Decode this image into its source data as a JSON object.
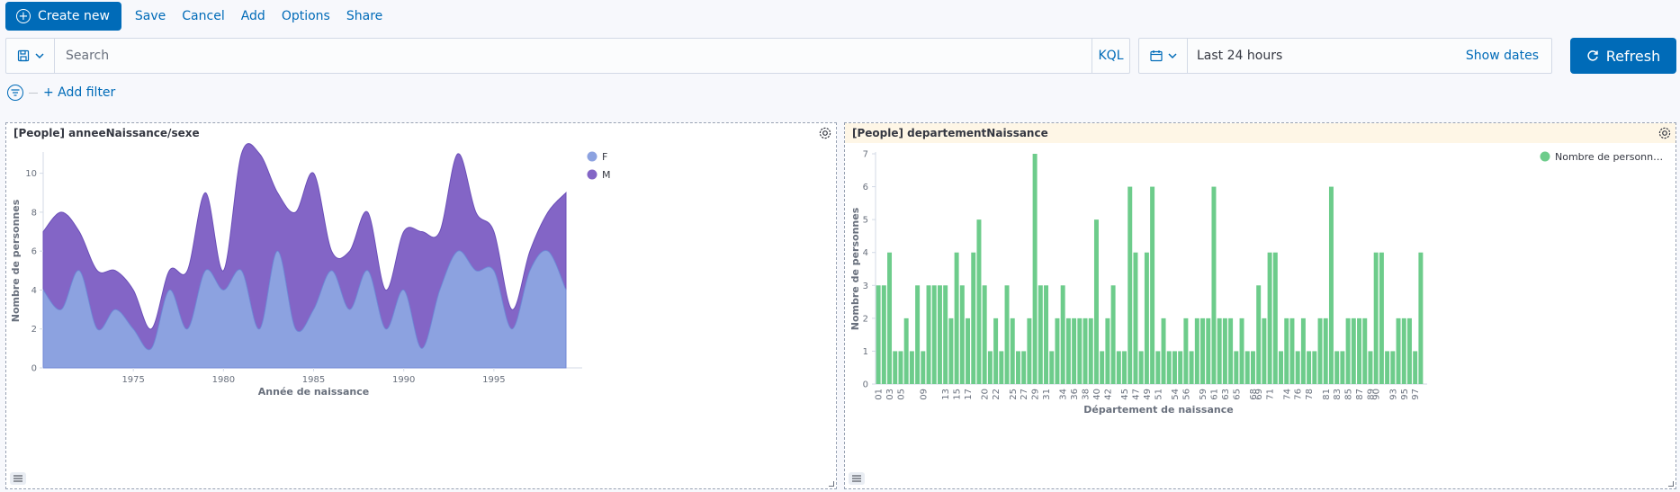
{
  "topnav": {
    "create_label": "Create new",
    "save": "Save",
    "cancel": "Cancel",
    "add": "Add",
    "options": "Options",
    "share": "Share"
  },
  "query": {
    "placeholder": "Search",
    "language": "KQL"
  },
  "time": {
    "range": "Last 24 hours",
    "show_dates": "Show dates"
  },
  "refresh_label": "Refresh",
  "filter": {
    "add_label": "+ Add filter"
  },
  "colors": {
    "accent": "#006bb8",
    "series_f": "#8ca2e0",
    "series_m": "#8365c6",
    "bars": "#6dcc8b"
  },
  "panels": {
    "left_title": "[People] anneeNaissance/sexe",
    "right_title": "[People] departementNaissance"
  },
  "chart_data": [
    {
      "type": "area",
      "stacked": true,
      "title": "",
      "xlabel": "Année de naissance",
      "ylabel": "Nombre de personnes",
      "xlim": [
        1970,
        1999
      ],
      "ylim": [
        0,
        11
      ],
      "xticks": [
        1975,
        1980,
        1985,
        1990,
        1995
      ],
      "yticks": [
        0,
        2,
        4,
        6,
        8,
        10
      ],
      "legend_position": "top-right",
      "x": [
        1970,
        1971,
        1972,
        1973,
        1974,
        1975,
        1976,
        1977,
        1978,
        1979,
        1980,
        1981,
        1982,
        1983,
        1984,
        1985,
        1986,
        1987,
        1988,
        1989,
        1990,
        1991,
        1992,
        1993,
        1994,
        1995,
        1996,
        1997,
        1998,
        1999
      ],
      "series": [
        {
          "name": "F",
          "values": [
            4,
            3,
            5,
            2,
            3,
            2,
            1,
            4,
            2,
            5,
            4,
            5,
            2,
            6,
            2,
            3,
            5,
            3,
            5,
            2,
            4,
            1,
            4,
            6,
            5,
            5,
            2,
            5,
            6,
            4
          ]
        },
        {
          "name": "M",
          "values": [
            3,
            5,
            2,
            3,
            2,
            2,
            1,
            1,
            3,
            4,
            1,
            6,
            9,
            3,
            6,
            7,
            1,
            3,
            3,
            2,
            3,
            6,
            3,
            5,
            3,
            2,
            1,
            1,
            2,
            5
          ]
        }
      ]
    },
    {
      "type": "bar",
      "title": "",
      "xlabel": "Département de naissance",
      "ylabel": "Nombre de personnes",
      "ylim": [
        0,
        7
      ],
      "yticks": [
        0,
        1,
        2,
        3,
        4,
        5,
        6,
        7
      ],
      "legend_position": "top-right",
      "series": [
        {
          "name": "Nombre de personn…"
        }
      ],
      "categories": [
        "01",
        "02",
        "03",
        "04",
        "05",
        "06",
        "07",
        "08",
        "09",
        "10",
        "11",
        "12",
        "13",
        "14",
        "15",
        "16",
        "17",
        "18",
        "19",
        "20",
        "21",
        "22",
        "23",
        "24",
        "25",
        "26",
        "27",
        "28",
        "29",
        "30",
        "31",
        "32",
        "33",
        "34",
        "35",
        "36",
        "37",
        "38",
        "39",
        "40",
        "41",
        "42",
        "43",
        "44",
        "45",
        "46",
        "47",
        "48",
        "49",
        "50",
        "51",
        "52",
        "53",
        "54",
        "55",
        "56",
        "57",
        "58",
        "59",
        "60",
        "61",
        "62",
        "63",
        "64",
        "65",
        "66",
        "67",
        "68",
        "69",
        "70",
        "71",
        "72",
        "73",
        "74",
        "75",
        "76",
        "77",
        "78",
        "79",
        "80",
        "81",
        "82",
        "83",
        "84",
        "85",
        "86",
        "87",
        "88",
        "89",
        "90",
        "91",
        "92",
        "93",
        "94",
        "95",
        "96",
        "97",
        "98"
      ],
      "values": [
        3,
        3,
        4,
        1,
        1,
        2,
        1,
        3,
        1,
        3,
        3,
        3,
        3,
        2,
        4,
        3,
        2,
        4,
        5,
        3,
        1,
        2,
        1,
        3,
        2,
        1,
        1,
        2,
        7,
        3,
        3,
        1,
        2,
        3,
        2,
        2,
        2,
        2,
        2,
        5,
        1,
        2,
        3,
        1,
        1,
        6,
        4,
        1,
        4,
        6,
        1,
        2,
        1,
        1,
        1,
        2,
        1,
        2,
        2,
        2,
        6,
        2,
        2,
        2,
        1,
        2,
        1,
        1,
        3,
        2,
        4,
        4,
        1,
        2,
        2,
        1,
        2,
        1,
        1,
        2,
        2,
        6,
        1,
        1,
        2,
        2,
        2,
        2,
        1,
        4,
        4,
        1,
        1,
        2,
        2,
        2,
        1,
        4
      ],
      "visible_tick_labels": [
        "01",
        "03",
        "05",
        "09",
        "13",
        "15",
        "17",
        "20",
        "22",
        "25",
        "27",
        "29",
        "31",
        "34",
        "36",
        "38",
        "40",
        "42",
        "45",
        "47",
        "49",
        "51",
        "54",
        "56",
        "59",
        "61",
        "63",
        "65",
        "68",
        "69",
        "71",
        "74",
        "76",
        "78",
        "81",
        "83",
        "85",
        "87",
        "89",
        "90",
        "93",
        "95",
        "97"
      ]
    }
  ]
}
